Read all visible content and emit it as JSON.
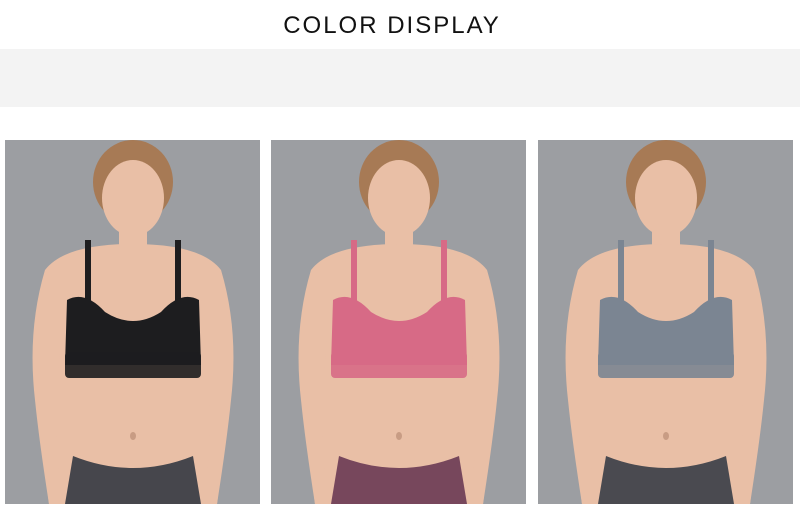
{
  "header": {
    "title": "COLOR DISPLAY"
  },
  "panels": [
    {
      "color_name": "black",
      "bra": "#1d1d1f",
      "pants": "#46464c",
      "backdrop": "#9c9ea2"
    },
    {
      "color_name": "pink",
      "bra": "#d76a86",
      "pants": "#77475c",
      "backdrop": "#9c9ea2"
    },
    {
      "color_name": "grey",
      "bra": "#7b8592",
      "pants": "#4a4a50",
      "backdrop": "#9c9ea2"
    }
  ],
  "palette": {
    "skin": "#e9bfa6",
    "hair": "#a77a55",
    "band_bg": "#f3f3f3"
  }
}
